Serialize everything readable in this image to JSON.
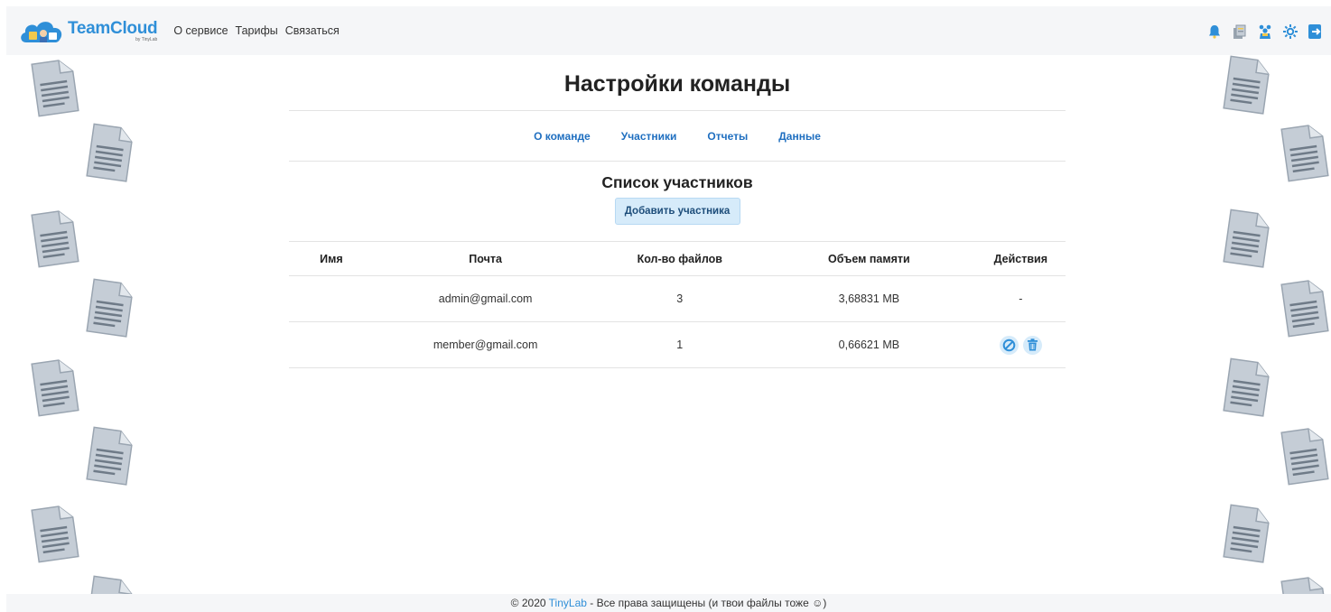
{
  "nav": {
    "brand_title": "TeamCloud",
    "brand_sub": "by TinyLab",
    "links": [
      "О сервисе",
      "Тарифы",
      "Связаться"
    ],
    "icons": [
      "bell-icon",
      "files-icon",
      "team-icon",
      "gear-icon",
      "logout-icon"
    ]
  },
  "main": {
    "title": "Настройки команды",
    "tabs": [
      "О команде",
      "Участники",
      "Отчеты",
      "Данные"
    ],
    "section_title": "Список участников",
    "add_button": "Добавить участника"
  },
  "table": {
    "headers": [
      "Имя",
      "Почта",
      "Кол-во файлов",
      "Объем памяти",
      "Действия"
    ],
    "rows": [
      {
        "name": "",
        "email": "admin@gmail.com",
        "files": "3",
        "memory": "3,68831 MB",
        "actions": "-"
      },
      {
        "name": "",
        "email": "member@gmail.com",
        "files": "1",
        "memory": "0,66621 MB",
        "actions": [
          "block-icon",
          "trash-icon"
        ]
      }
    ]
  },
  "footer": {
    "copy": "© 2020",
    "link": "TinyLab",
    "text": "- Все права защищены (и твои файлы тоже ☺)"
  },
  "colors": {
    "accent": "#2f8fd8",
    "link": "#1f6fc0",
    "navbar_bg": "#f5f6f8",
    "button_bg": "#d6ebfa",
    "doc_icon": "#c5cdd6"
  }
}
